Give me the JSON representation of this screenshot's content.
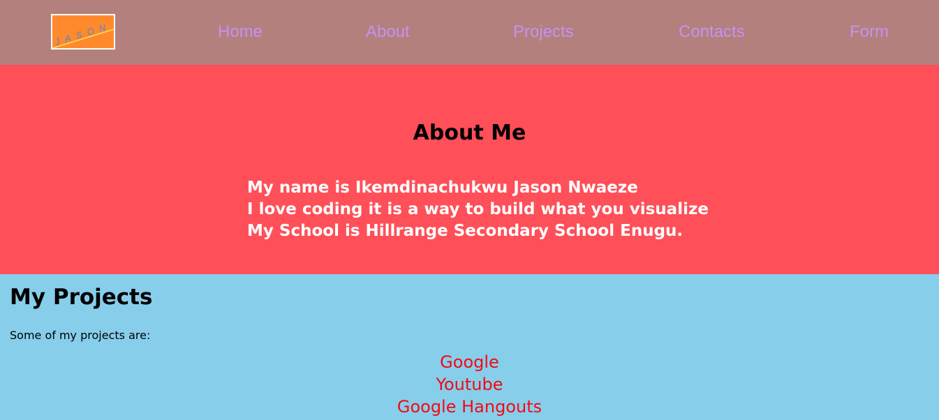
{
  "nav": {
    "logo_text": "JASON",
    "links": [
      {
        "label": "Home"
      },
      {
        "label": "About"
      },
      {
        "label": "Projects"
      },
      {
        "label": "Contacts"
      },
      {
        "label": "Form"
      }
    ]
  },
  "about": {
    "title": "About Me",
    "lines": [
      "My name is Ikemdinachukwu Jason Nwaeze",
      "I love coding it is a way to build what you visualize",
      "My School is Hillrange Secondary School Enugu."
    ]
  },
  "projects": {
    "title": "My Projects",
    "intro": "Some of my projects are:",
    "items": [
      {
        "label": "Google"
      },
      {
        "label": "Youtube"
      },
      {
        "label": "Google Hangouts"
      }
    ]
  },
  "colors": {
    "navbar_bg": "#B3807E",
    "nav_link": "#C890F2",
    "about_bg": "#FF4F58",
    "projects_bg": "#87CEEB",
    "project_link": "#F20A12",
    "logo_bg": "#FF8A2E"
  }
}
